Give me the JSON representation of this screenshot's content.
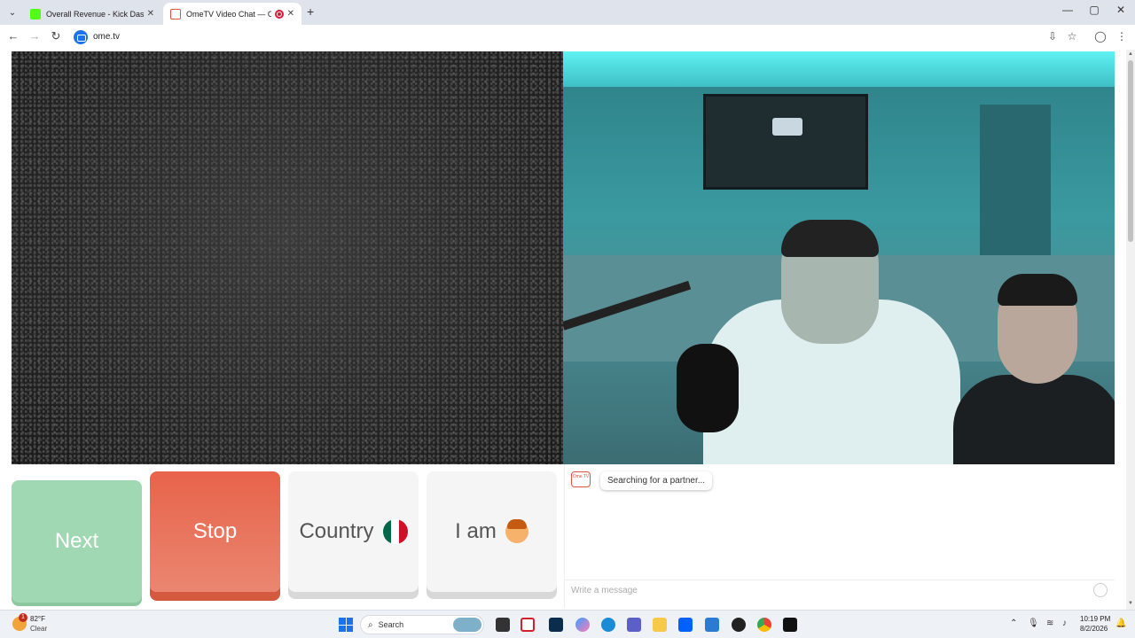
{
  "browser": {
    "tabs": [
      {
        "title": "Overall Revenue - Kick Dashboard",
        "favicon_color": "#53fc18",
        "active": false
      },
      {
        "title": "OmeTV Video Chat — OmeTV",
        "favicon_color": "#e0543e",
        "active": true
      }
    ],
    "url": "ome.tv",
    "new_tab_symbol": "+",
    "window_controls": {
      "minimize": "—",
      "maximize": "▢",
      "close": "✕"
    },
    "nav": {
      "back": "←",
      "forward": "→",
      "reload": "↻"
    },
    "toolbar_icons": {
      "install": "⇩",
      "bookmark": "☆",
      "profile": "◯",
      "menu": "⋮"
    }
  },
  "controls": {
    "next_label": "Next",
    "stop_label": "Stop",
    "country_label": "Country",
    "iam_label": "I am",
    "country_flag_colors": [
      "#006847",
      "#ffffff",
      "#ce1126"
    ]
  },
  "chat": {
    "logo_text": "Ome TV",
    "status_message": "Searching for a partner...",
    "input_placeholder": "Write a message"
  },
  "taskbar": {
    "weather_temp": "82°F",
    "weather_desc": "Clear",
    "weather_badge": "1",
    "search_label": "Search",
    "time": "10:19 PM",
    "date": "8/2/2026",
    "apps": [
      "file-explorer",
      "acrobat",
      "photoshop",
      "copilot",
      "edge",
      "teams",
      "folder",
      "dropbox",
      "store",
      "obs",
      "chrome",
      "audio-app"
    ]
  },
  "colors": {
    "stop_button": "#e8634a",
    "next_button": "#9fd8b3",
    "accent": "#1a73e8"
  }
}
